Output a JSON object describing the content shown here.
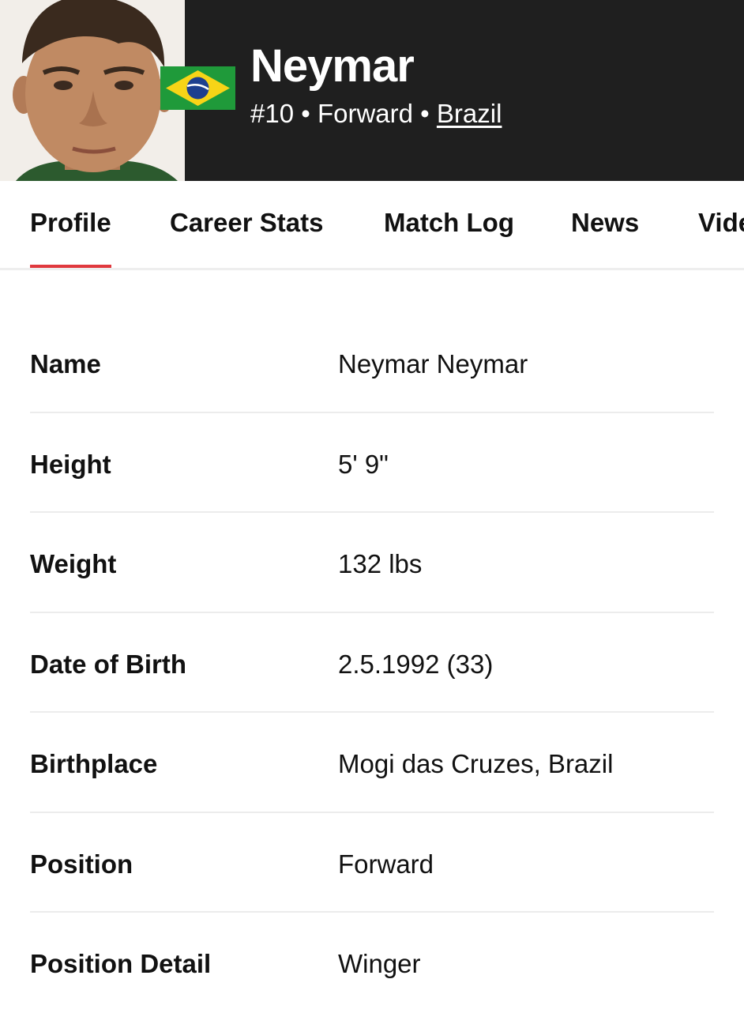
{
  "player": {
    "name": "Neymar",
    "number": "#10",
    "position": "Forward",
    "country": "Brazil",
    "separator": "•"
  },
  "tabs": [
    {
      "label": "Profile",
      "active": true
    },
    {
      "label": "Career Stats"
    },
    {
      "label": "Match Log"
    },
    {
      "label": "News"
    },
    {
      "label": "Videos"
    }
  ],
  "profile": [
    {
      "label": "Name",
      "value": "Neymar Neymar"
    },
    {
      "label": "Height",
      "value": "5' 9\""
    },
    {
      "label": "Weight",
      "value": "132 lbs"
    },
    {
      "label": "Date of Birth",
      "value": "2.5.1992 (33)"
    },
    {
      "label": "Birthplace",
      "value": "Mogi das Cruzes, Brazil"
    },
    {
      "label": "Position",
      "value": "Forward"
    },
    {
      "label": "Position Detail",
      "value": "Winger"
    }
  ],
  "colors": {
    "header_bg": "#1f1f1f",
    "accent": "#e0393e",
    "flag_green": "#1f9a3a",
    "flag_yellow": "#f7d417",
    "flag_blue": "#1d3f8f"
  }
}
